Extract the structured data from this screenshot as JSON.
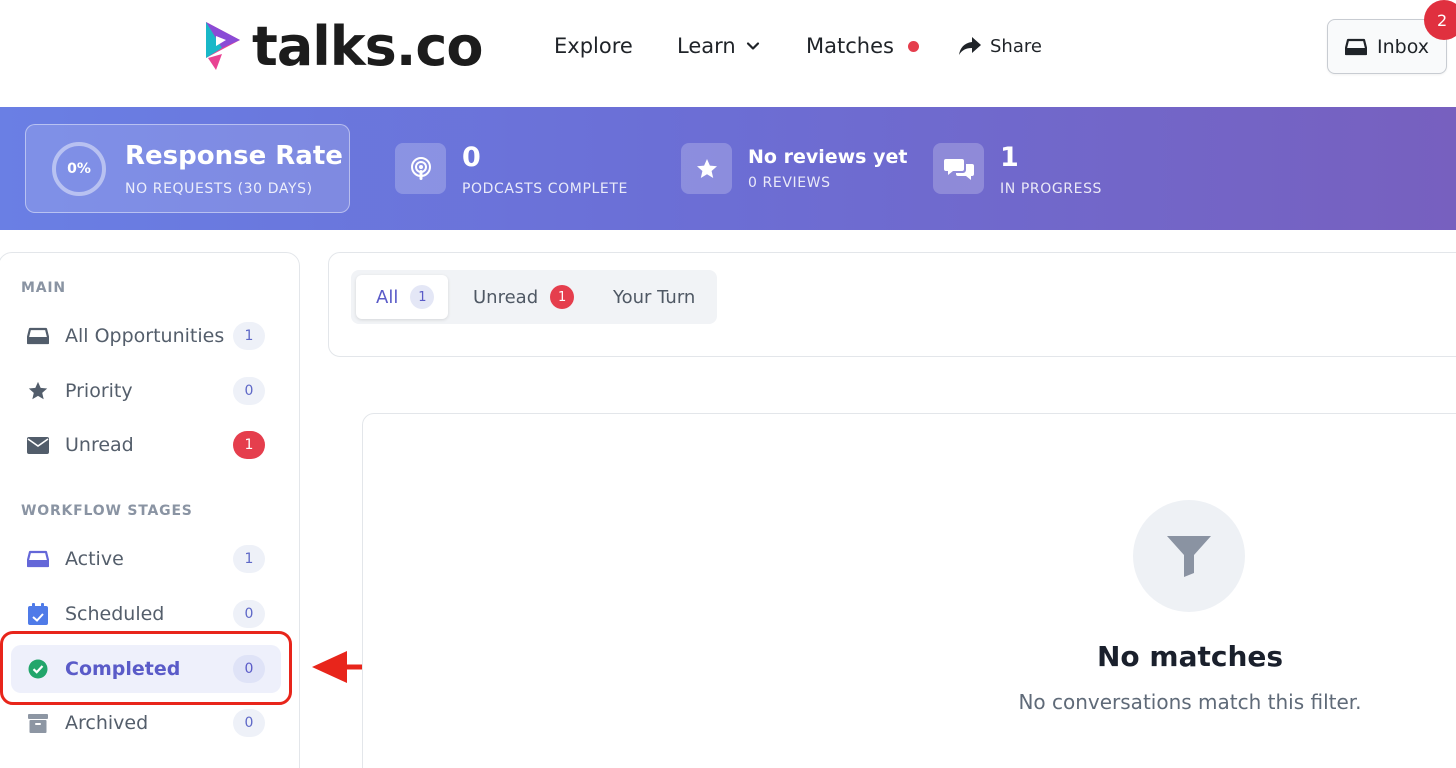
{
  "header": {
    "logo_text": "talks.co",
    "nav": {
      "explore": "Explore",
      "learn": "Learn",
      "matches": "Matches",
      "share": "Share"
    },
    "inbox_label": "Inbox",
    "inbox_badge": "2"
  },
  "stats": {
    "response_rate": {
      "percent": "0%",
      "title": "Response Rate",
      "subtitle": "NO REQUESTS (30 DAYS)"
    },
    "podcasts": {
      "value": "0",
      "label": "PODCASTS COMPLETE"
    },
    "reviews": {
      "value": "No reviews yet",
      "label": "0 REVIEWS"
    },
    "in_progress": {
      "value": "1",
      "label": "IN PROGRESS"
    }
  },
  "sidebar": {
    "main_title": "MAIN",
    "main_items": [
      {
        "label": "All Opportunities",
        "count": "1"
      },
      {
        "label": "Priority",
        "count": "0"
      },
      {
        "label": "Unread",
        "count": "1"
      }
    ],
    "workflow_title": "WORKFLOW STAGES",
    "workflow_items": [
      {
        "label": "Active",
        "count": "1"
      },
      {
        "label": "Scheduled",
        "count": "0"
      },
      {
        "label": "Completed",
        "count": "0"
      },
      {
        "label": "Archived",
        "count": "0"
      }
    ]
  },
  "filters": {
    "tabs": [
      {
        "label": "All",
        "count": "1"
      },
      {
        "label": "Unread",
        "count": "1"
      },
      {
        "label": "Your Turn"
      }
    ]
  },
  "empty_state": {
    "title": "No matches",
    "subtitle": "No conversations match this filter."
  },
  "colors": {
    "accent": "#5a5bc8",
    "badge_red": "#e53e4d",
    "annotation_red": "#e8251b",
    "banner_start": "#6a7fe4",
    "banner_end": "#7760bf"
  },
  "icons": {
    "stat_podcasts": "podcast-icon",
    "stat_reviews": "star-icon",
    "stat_in_progress": "chat-icon",
    "empty_state": "filter-icon"
  }
}
